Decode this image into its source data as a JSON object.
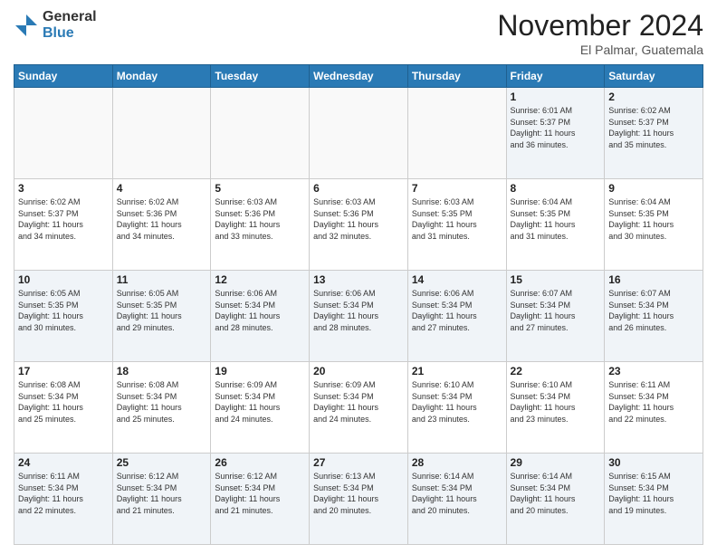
{
  "header": {
    "logo_general": "General",
    "logo_blue": "Blue",
    "month_title": "November 2024",
    "location": "El Palmar, Guatemala"
  },
  "columns": [
    "Sunday",
    "Monday",
    "Tuesday",
    "Wednesday",
    "Thursday",
    "Friday",
    "Saturday"
  ],
  "weeks": [
    [
      {
        "day": "",
        "info": "",
        "empty": true
      },
      {
        "day": "",
        "info": "",
        "empty": true
      },
      {
        "day": "",
        "info": "",
        "empty": true
      },
      {
        "day": "",
        "info": "",
        "empty": true
      },
      {
        "day": "",
        "info": "",
        "empty": true
      },
      {
        "day": "1",
        "info": "Sunrise: 6:01 AM\nSunset: 5:37 PM\nDaylight: 11 hours\nand 36 minutes.",
        "empty": false
      },
      {
        "day": "2",
        "info": "Sunrise: 6:02 AM\nSunset: 5:37 PM\nDaylight: 11 hours\nand 35 minutes.",
        "empty": false
      }
    ],
    [
      {
        "day": "3",
        "info": "Sunrise: 6:02 AM\nSunset: 5:37 PM\nDaylight: 11 hours\nand 34 minutes.",
        "empty": false
      },
      {
        "day": "4",
        "info": "Sunrise: 6:02 AM\nSunset: 5:36 PM\nDaylight: 11 hours\nand 34 minutes.",
        "empty": false
      },
      {
        "day": "5",
        "info": "Sunrise: 6:03 AM\nSunset: 5:36 PM\nDaylight: 11 hours\nand 33 minutes.",
        "empty": false
      },
      {
        "day": "6",
        "info": "Sunrise: 6:03 AM\nSunset: 5:36 PM\nDaylight: 11 hours\nand 32 minutes.",
        "empty": false
      },
      {
        "day": "7",
        "info": "Sunrise: 6:03 AM\nSunset: 5:35 PM\nDaylight: 11 hours\nand 31 minutes.",
        "empty": false
      },
      {
        "day": "8",
        "info": "Sunrise: 6:04 AM\nSunset: 5:35 PM\nDaylight: 11 hours\nand 31 minutes.",
        "empty": false
      },
      {
        "day": "9",
        "info": "Sunrise: 6:04 AM\nSunset: 5:35 PM\nDaylight: 11 hours\nand 30 minutes.",
        "empty": false
      }
    ],
    [
      {
        "day": "10",
        "info": "Sunrise: 6:05 AM\nSunset: 5:35 PM\nDaylight: 11 hours\nand 30 minutes.",
        "empty": false
      },
      {
        "day": "11",
        "info": "Sunrise: 6:05 AM\nSunset: 5:35 PM\nDaylight: 11 hours\nand 29 minutes.",
        "empty": false
      },
      {
        "day": "12",
        "info": "Sunrise: 6:06 AM\nSunset: 5:34 PM\nDaylight: 11 hours\nand 28 minutes.",
        "empty": false
      },
      {
        "day": "13",
        "info": "Sunrise: 6:06 AM\nSunset: 5:34 PM\nDaylight: 11 hours\nand 28 minutes.",
        "empty": false
      },
      {
        "day": "14",
        "info": "Sunrise: 6:06 AM\nSunset: 5:34 PM\nDaylight: 11 hours\nand 27 minutes.",
        "empty": false
      },
      {
        "day": "15",
        "info": "Sunrise: 6:07 AM\nSunset: 5:34 PM\nDaylight: 11 hours\nand 27 minutes.",
        "empty": false
      },
      {
        "day": "16",
        "info": "Sunrise: 6:07 AM\nSunset: 5:34 PM\nDaylight: 11 hours\nand 26 minutes.",
        "empty": false
      }
    ],
    [
      {
        "day": "17",
        "info": "Sunrise: 6:08 AM\nSunset: 5:34 PM\nDaylight: 11 hours\nand 25 minutes.",
        "empty": false
      },
      {
        "day": "18",
        "info": "Sunrise: 6:08 AM\nSunset: 5:34 PM\nDaylight: 11 hours\nand 25 minutes.",
        "empty": false
      },
      {
        "day": "19",
        "info": "Sunrise: 6:09 AM\nSunset: 5:34 PM\nDaylight: 11 hours\nand 24 minutes.",
        "empty": false
      },
      {
        "day": "20",
        "info": "Sunrise: 6:09 AM\nSunset: 5:34 PM\nDaylight: 11 hours\nand 24 minutes.",
        "empty": false
      },
      {
        "day": "21",
        "info": "Sunrise: 6:10 AM\nSunset: 5:34 PM\nDaylight: 11 hours\nand 23 minutes.",
        "empty": false
      },
      {
        "day": "22",
        "info": "Sunrise: 6:10 AM\nSunset: 5:34 PM\nDaylight: 11 hours\nand 23 minutes.",
        "empty": false
      },
      {
        "day": "23",
        "info": "Sunrise: 6:11 AM\nSunset: 5:34 PM\nDaylight: 11 hours\nand 22 minutes.",
        "empty": false
      }
    ],
    [
      {
        "day": "24",
        "info": "Sunrise: 6:11 AM\nSunset: 5:34 PM\nDaylight: 11 hours\nand 22 minutes.",
        "empty": false
      },
      {
        "day": "25",
        "info": "Sunrise: 6:12 AM\nSunset: 5:34 PM\nDaylight: 11 hours\nand 21 minutes.",
        "empty": false
      },
      {
        "day": "26",
        "info": "Sunrise: 6:12 AM\nSunset: 5:34 PM\nDaylight: 11 hours\nand 21 minutes.",
        "empty": false
      },
      {
        "day": "27",
        "info": "Sunrise: 6:13 AM\nSunset: 5:34 PM\nDaylight: 11 hours\nand 20 minutes.",
        "empty": false
      },
      {
        "day": "28",
        "info": "Sunrise: 6:14 AM\nSunset: 5:34 PM\nDaylight: 11 hours\nand 20 minutes.",
        "empty": false
      },
      {
        "day": "29",
        "info": "Sunrise: 6:14 AM\nSunset: 5:34 PM\nDaylight: 11 hours\nand 20 minutes.",
        "empty": false
      },
      {
        "day": "30",
        "info": "Sunrise: 6:15 AM\nSunset: 5:34 PM\nDaylight: 11 hours\nand 19 minutes.",
        "empty": false
      }
    ]
  ]
}
